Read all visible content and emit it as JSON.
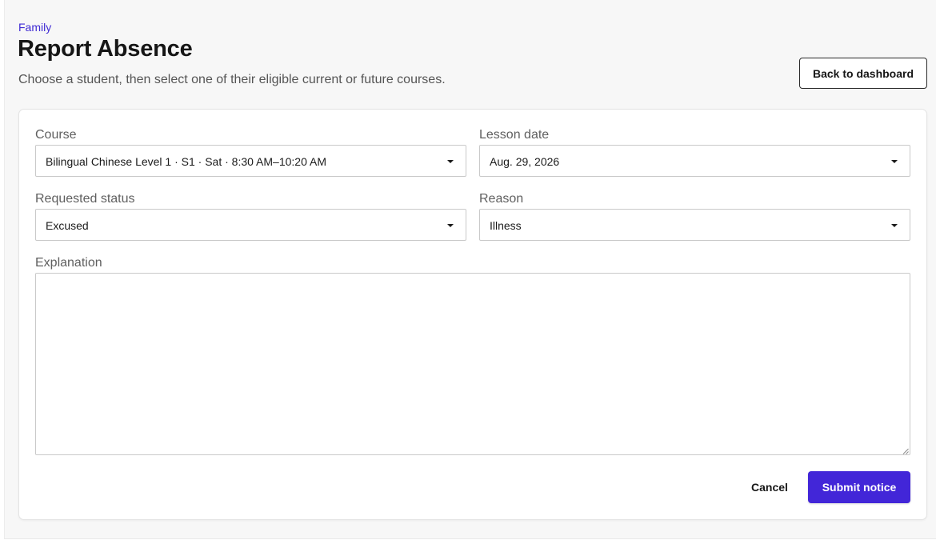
{
  "header": {
    "eyebrow": "Family",
    "title": "Report Absence",
    "subtitle": "Choose a student, then select one of their eligible current or future courses.",
    "back_label": "Back to dashboard"
  },
  "form": {
    "course": {
      "label": "Course",
      "value": "Bilingual Chinese Level 1 · S1 · Sat · 8:30 AM–10:20 AM"
    },
    "lesson_date": {
      "label": "Lesson date",
      "value": "Aug. 29, 2026"
    },
    "requested_status": {
      "label": "Requested status",
      "value": "Excused"
    },
    "reason": {
      "label": "Reason",
      "value": "Illness"
    },
    "explanation": {
      "label": "Explanation",
      "value": ""
    },
    "cancel_label": "Cancel",
    "submit_label": "Submit notice"
  },
  "colors": {
    "accent": "#4226d8",
    "eyebrow": "#3f2bd4",
    "page_background": "#f7f7f7",
    "card_background": "#ffffff"
  },
  "icons": {
    "dropdown": "chevron-down-icon",
    "resize": "resize-grip-icon"
  }
}
